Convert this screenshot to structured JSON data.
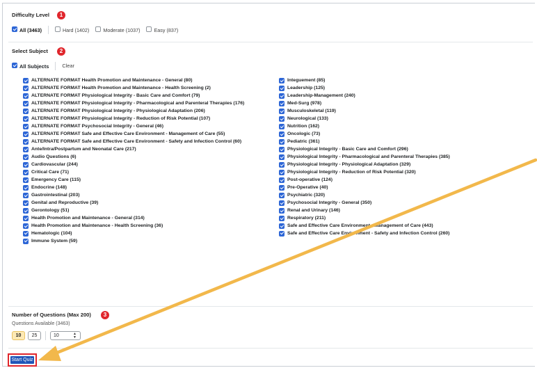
{
  "difficulty": {
    "title": "Difficulty Level",
    "badge": "1",
    "options": [
      {
        "label": "All (3463)",
        "checked": true
      },
      {
        "label": "Hard (1402)",
        "checked": false
      },
      {
        "label": "Moderate (1037)",
        "checked": false
      },
      {
        "label": "Easy (837)",
        "checked": false
      }
    ]
  },
  "subject": {
    "title": "Select Subject",
    "badge": "2",
    "all_label": "All Subjects",
    "clear_label": "Clear",
    "left_items": [
      "ALTERNATE FORMAT Health Promotion and Maintenance - General (80)",
      "ALTERNATE FORMAT Health Promotion and Maintenance - Health Screening (2)",
      "ALTERNATE FORMAT Physiological Integrity - Basic Care and Comfort (79)",
      "ALTERNATE FORMAT Physiological Integrity - Pharmacological and Parenteral Therapies (176)",
      "ALTERNATE FORMAT Physiological Integrity - Physiological Adaptation (206)",
      "ALTERNATE FORMAT Physiological Integrity - Reduction of Risk Potential (107)",
      "ALTERNATE FORMAT Psychosocial Integrity - General (46)",
      "ALTERNATE FORMAT Safe and Effective Care Environment - Management of Care (55)",
      "ALTERNATE FORMAT Safe and Effective Care Environment - Safety and Infection Control (60)",
      "Ante/Intra/Postpartum and Neonatal Care (217)",
      "Audio Questions (6)",
      "Cardiovascular (244)",
      "Critical Care (71)",
      "Emergency Care (115)",
      "Endocrine (148)",
      "Gastrointestinal (203)",
      "Genital and Reproductive (39)",
      "Gerontology (51)",
      "Health Promotion and Maintenance - General (314)",
      "Health Promotion and Maintenance - Health Screening (36)",
      "Hematologic (104)",
      "Immune System (59)"
    ],
    "right_items": [
      "Integuement (85)",
      "Leadership (125)",
      "Leadership-Management (240)",
      "Med-Surg (978)",
      "Musculoskeletal (119)",
      "Neurological (133)",
      "Nutrition (162)",
      "Oncologic (73)",
      "Pediatric (361)",
      "Physiological Integrity - Basic Care and Comfort (296)",
      "Physiological Integrity - Pharmacological and Parenteral Therapies (385)",
      "Physiological Integrity - Physiological Adaptation (329)",
      "Physiological Integrity - Reduction of Risk Potential (320)",
      "Post-operative (124)",
      "Pre-Operative (40)",
      "Psychiatric (320)",
      "Psychosocial Integrity - General (350)",
      "Renal and Urinary (146)",
      "Respiratory (211)",
      "Safe and Effective Care Environment - Management of Care (443)",
      "Safe and Effective Care Environment - Safety and Infection Control (260)"
    ]
  },
  "questions": {
    "title": "Number of Questions (Max 200)",
    "badge": "3",
    "available": "Questions Available (3463)",
    "preset_10": "10",
    "preset_25": "25",
    "custom_value": "10"
  },
  "start_button": "Start Quiz",
  "colors": {
    "accent": "#2d66d6",
    "badge": "#e0262c",
    "arrow": "#f2b84b",
    "button": "#1f55b8"
  }
}
